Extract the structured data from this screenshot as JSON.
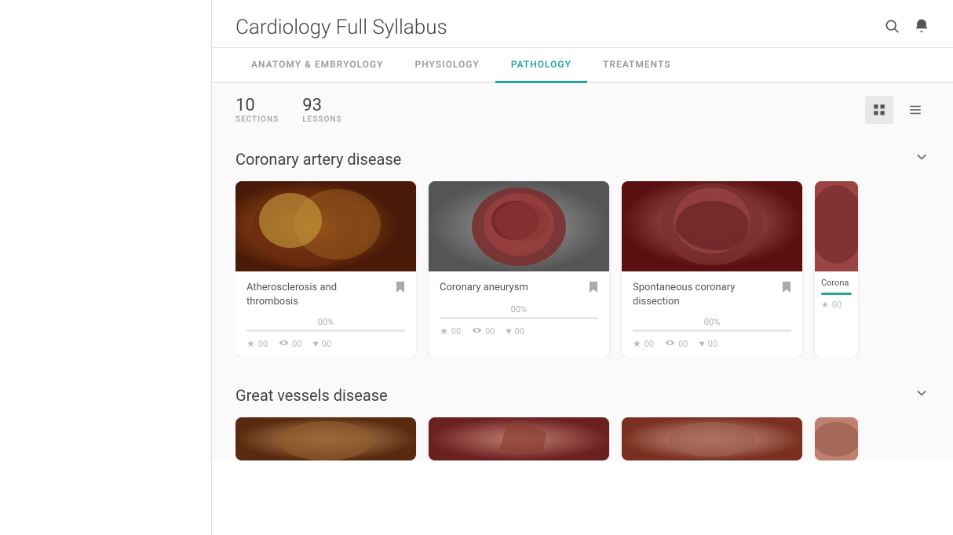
{
  "header": {
    "title": "Cardiology Full Syllabus",
    "search_icon": "🔍",
    "bell_icon": "🔔"
  },
  "tabs": [
    {
      "label": "ANATOMY & EMBRYOLOGY",
      "active": false
    },
    {
      "label": "PHYSIOLOGY",
      "active": false
    },
    {
      "label": "PATHOLOGY",
      "active": true
    },
    {
      "label": "TREATMENTS",
      "active": false
    }
  ],
  "stats": {
    "sections_count": "10",
    "sections_label": "SECTIONS",
    "lessons_count": "93",
    "lessons_label": "LESSONS"
  },
  "sections": [
    {
      "id": "coronary-artery",
      "title": "Coronary artery disease",
      "cards": [
        {
          "id": "card-atherosclerosis",
          "title": "Atherosclerosis and thrombosis",
          "progress": "00%",
          "progress_value": 0,
          "stars": "00",
          "views": "00",
          "likes": "00",
          "img_class": "img-athero"
        },
        {
          "id": "card-aneurysm",
          "title": "Coronary aneurysm",
          "progress": "00%",
          "progress_value": 0,
          "stars": "00",
          "views": "00",
          "likes": "00",
          "img_class": "img-aneurysm"
        },
        {
          "id": "card-spontaneous",
          "title": "Spontaneous coronary dissection",
          "progress": "00%",
          "progress_value": 0,
          "stars": "00",
          "views": "00",
          "likes": "00",
          "img_class": "img-spontaneous"
        }
      ],
      "partial_card": {
        "title": "Corona",
        "stars": "00",
        "img_class": "img-corona-partial"
      }
    },
    {
      "id": "great-vessels",
      "title": "Great vessels disease",
      "cards": [
        {
          "img_class": "img-vessels1"
        },
        {
          "img_class": "img-vessels2"
        },
        {
          "img_class": "img-vessels3"
        },
        {
          "img_class": "img-vessels4"
        }
      ]
    }
  ],
  "icons": {
    "grid": "⊞",
    "list": "≡",
    "chevron_down": "⌄",
    "bookmark": "🔖",
    "star": "★",
    "eye": "👁",
    "heart": "♥"
  }
}
